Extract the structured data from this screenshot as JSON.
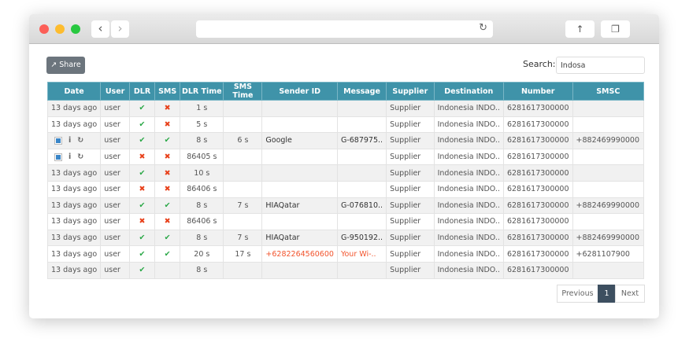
{
  "toolbar": {
    "share_label": "Share",
    "search_label": "Search:",
    "search_value": "Indosa"
  },
  "columns": [
    "Date",
    "User",
    "DLR",
    "SMS",
    "DLR Time",
    "SMS Time",
    "Sender ID",
    "Message",
    "Supplier",
    "Destination",
    "Number",
    "SMSC"
  ],
  "rows": [
    {
      "date": "13 days ago",
      "user": "user",
      "dlr": "ok",
      "sms": "no",
      "dlr_time": "1 s",
      "sms_time": "",
      "sender": "",
      "message": "",
      "supplier": "Supplier",
      "destination": "Indonesia INDO..",
      "number": "6281617300000",
      "smsc": ""
    },
    {
      "date": "13 days ago",
      "user": "user",
      "dlr": "ok",
      "sms": "no",
      "dlr_time": "5 s",
      "sms_time": "",
      "sender": "",
      "message": "",
      "supplier": "Supplier",
      "destination": "Indonesia INDO..",
      "number": "6281617300000",
      "smsc": ""
    },
    {
      "date": "",
      "actions": true,
      "user": "user",
      "dlr": "ok",
      "sms": "ok",
      "dlr_time": "8 s",
      "sms_time": "6 s",
      "sender": "Google",
      "message": "G-687975..",
      "supplier": "Supplier",
      "destination": "Indonesia INDO..",
      "number": "6281617300000",
      "smsc": "+882469990000"
    },
    {
      "date": "",
      "actions": true,
      "user": "user",
      "dlr": "no",
      "sms": "no",
      "dlr_time": "86405 s",
      "sms_time": "",
      "sender": "",
      "message": "",
      "supplier": "Supplier",
      "destination": "Indonesia INDO..",
      "number": "6281617300000",
      "smsc": ""
    },
    {
      "date": "13 days ago",
      "user": "user",
      "dlr": "ok",
      "sms": "no",
      "dlr_time": "10 s",
      "sms_time": "",
      "sender": "",
      "message": "",
      "supplier": "Supplier",
      "destination": "Indonesia INDO..",
      "number": "6281617300000",
      "smsc": ""
    },
    {
      "date": "13 days ago",
      "user": "user",
      "dlr": "no",
      "sms": "no",
      "dlr_time": "86406 s",
      "sms_time": "",
      "sender": "",
      "message": "",
      "supplier": "Supplier",
      "destination": "Indonesia INDO..",
      "number": "6281617300000",
      "smsc": ""
    },
    {
      "date": "13 days ago",
      "user": "user",
      "dlr": "ok",
      "sms": "ok",
      "dlr_time": "8 s",
      "sms_time": "7 s",
      "sender": "HIAQatar",
      "message": "G-076810..",
      "supplier": "Supplier",
      "destination": "Indonesia INDO..",
      "number": "6281617300000",
      "smsc": "+882469990000"
    },
    {
      "date": "13 days ago",
      "user": "user",
      "dlr": "no",
      "sms": "no",
      "dlr_time": "86406 s",
      "sms_time": "",
      "sender": "",
      "message": "",
      "supplier": "Supplier",
      "destination": "Indonesia INDO..",
      "number": "6281617300000",
      "smsc": ""
    },
    {
      "date": "13 days ago",
      "user": "user",
      "dlr": "ok",
      "sms": "ok",
      "dlr_time": "8 s",
      "sms_time": "7 s",
      "sender": "HIAQatar",
      "message": "G-950192..",
      "supplier": "Supplier",
      "destination": "Indonesia INDO..",
      "number": "6281617300000",
      "smsc": "+882469990000"
    },
    {
      "date": "13 days ago",
      "user": "user",
      "dlr": "ok",
      "sms": "ok",
      "dlr_time": "20 s",
      "sms_time": "17 s",
      "sender": "+6282264560600",
      "message": "Your Wi-..",
      "highlight": true,
      "supplier": "Supplier",
      "destination": "Indonesia INDO..",
      "number": "6281617300000",
      "smsc": "+6281107900"
    },
    {
      "date": "13 days ago",
      "user": "user",
      "dlr": "ok",
      "sms": "",
      "dlr_time": "8 s",
      "sms_time": "",
      "sender": "",
      "message": "",
      "supplier": "Supplier",
      "destination": "Indonesia INDO..",
      "number": "6281617300000",
      "smsc": ""
    }
  ],
  "pagination": {
    "previous": "Previous",
    "current": "1",
    "next": "Next"
  },
  "colors": {
    "header": "#3f93a9",
    "ok": "#28a745",
    "no": "#e8421c",
    "highlight": "#f2542d",
    "active_page": "#3d4f60"
  }
}
